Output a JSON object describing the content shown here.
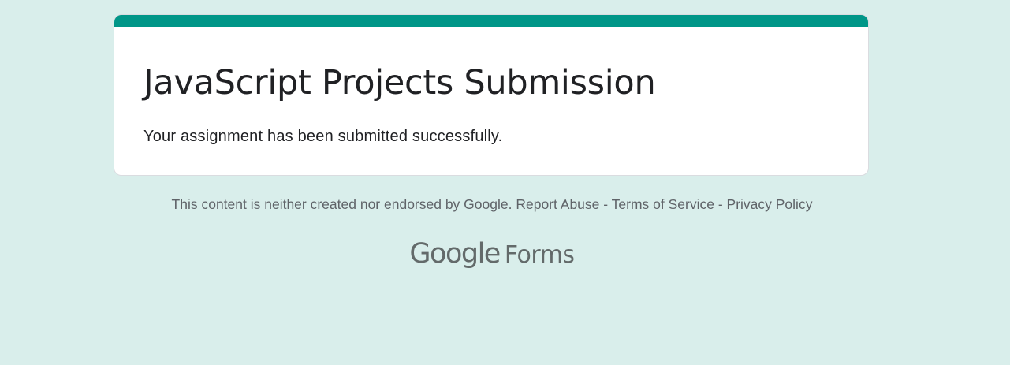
{
  "form": {
    "title": "JavaScript Projects Submission",
    "confirmation_message": "Your assignment has been submitted successfully."
  },
  "footer": {
    "disclaimer": "This content is neither created nor endorsed by Google.",
    "separator": "-",
    "report_abuse": "Report Abuse",
    "terms": "Terms of Service",
    "privacy": "Privacy Policy"
  },
  "brand": {
    "google": "Google",
    "forms": "Forms"
  },
  "colors": {
    "background": "#d9eeeb",
    "accent": "#009688",
    "card": "#ffffff",
    "text_primary": "#202124",
    "text_secondary": "#5f6368"
  }
}
